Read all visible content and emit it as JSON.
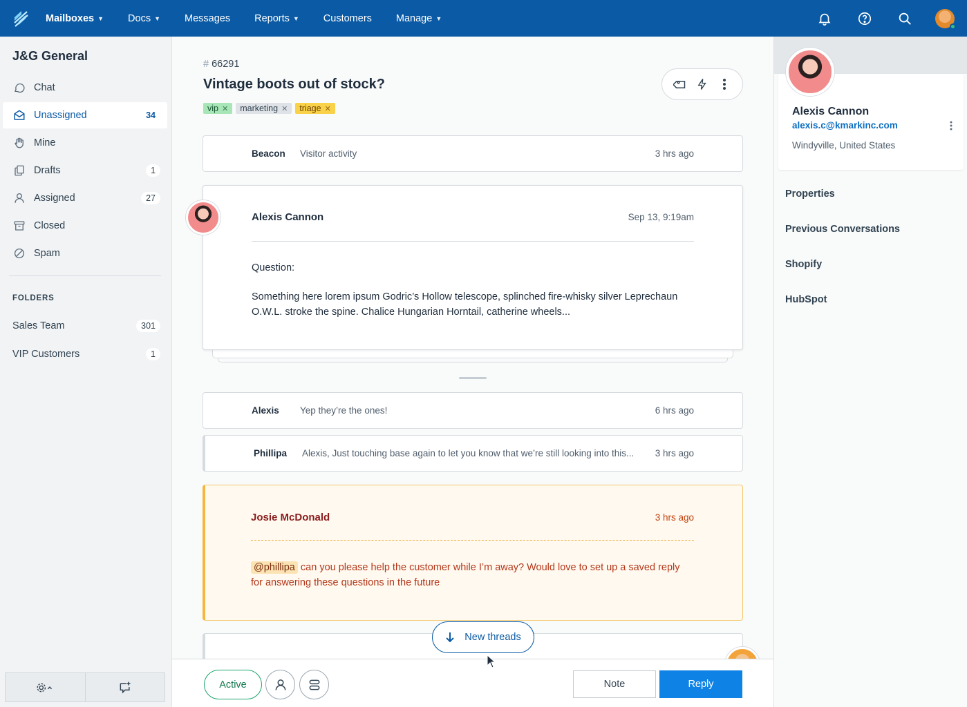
{
  "nav": {
    "items": [
      {
        "label": "Mailboxes",
        "caret": true
      },
      {
        "label": "Docs",
        "caret": true
      },
      {
        "label": "Messages",
        "caret": false
      },
      {
        "label": "Reports",
        "caret": true
      },
      {
        "label": "Customers",
        "caret": false
      },
      {
        "label": "Manage",
        "caret": true
      }
    ],
    "icons": [
      "bell-icon",
      "help-icon",
      "search-icon",
      "user-avatar"
    ]
  },
  "sidebar": {
    "mailbox_title": "J&G General",
    "items": [
      {
        "label": "Chat",
        "count": "",
        "icon": "chat-icon"
      },
      {
        "label": "Unassigned",
        "count": "34",
        "icon": "inbox-icon",
        "active": true
      },
      {
        "label": "Mine",
        "count": "",
        "icon": "hand-icon"
      },
      {
        "label": "Drafts",
        "count": "1",
        "icon": "drafts-icon"
      },
      {
        "label": "Assigned",
        "count": "27",
        "icon": "person-icon"
      },
      {
        "label": "Closed",
        "count": "",
        "icon": "archive-icon"
      },
      {
        "label": "Spam",
        "count": "",
        "icon": "spam-icon"
      }
    ],
    "folders_heading": "FOLDERS",
    "folders": [
      {
        "label": "Sales Team",
        "count": "301"
      },
      {
        "label": "VIP Customers",
        "count": "1"
      }
    ]
  },
  "conversation": {
    "number_hash": "#",
    "number": "66291",
    "subject": "Vintage boots out of stock?",
    "tags": [
      {
        "label": "vip",
        "bg": "#a8e6b8",
        "fg": "#14532d"
      },
      {
        "label": "marketing",
        "bg": "#dfe3e7",
        "fg": "#314351"
      },
      {
        "label": "triage",
        "bg": "#f9d24a",
        "fg": "#6b3e00"
      }
    ],
    "beacon": {
      "who": "Beacon",
      "preview": "Visitor activity",
      "time": "3 hrs ago"
    },
    "message": {
      "name": "Alexis Cannon",
      "time": "Sep 13, 9:19am",
      "question": "Question:",
      "body": "Something here lorem ipsum Godric’s Hollow telescope, splinched fire-whisky silver Leprechaun O.W.L. stroke the spine. Chalice Hungarian Horntail, catherine wheels..."
    },
    "thread1": {
      "who": "Alexis",
      "preview": "Yep they’re the ones!",
      "time": "6 hrs ago"
    },
    "thread2": {
      "who": "Phillipa",
      "preview": "Alexis, Just touching base again to let you know that we’re still looking into this...",
      "time": "3 hrs ago"
    },
    "note": {
      "name": "Josie McDonald",
      "time": "3 hrs ago",
      "mention": "@phillipa",
      "body": "can you please help the customer while I’m away? Would love to set up a saved reply for answering these questions in the future"
    },
    "new_threads_label": "New threads"
  },
  "footer": {
    "status": "Active",
    "note_label": "Note",
    "reply_label": "Reply"
  },
  "customer": {
    "name": "Alexis Cannon",
    "email": "alexis.c@kmarkinc.com",
    "location": "Windyville, United States",
    "sections": [
      "Properties",
      "Previous Conversations",
      "Shopify",
      "HubSpot"
    ]
  }
}
